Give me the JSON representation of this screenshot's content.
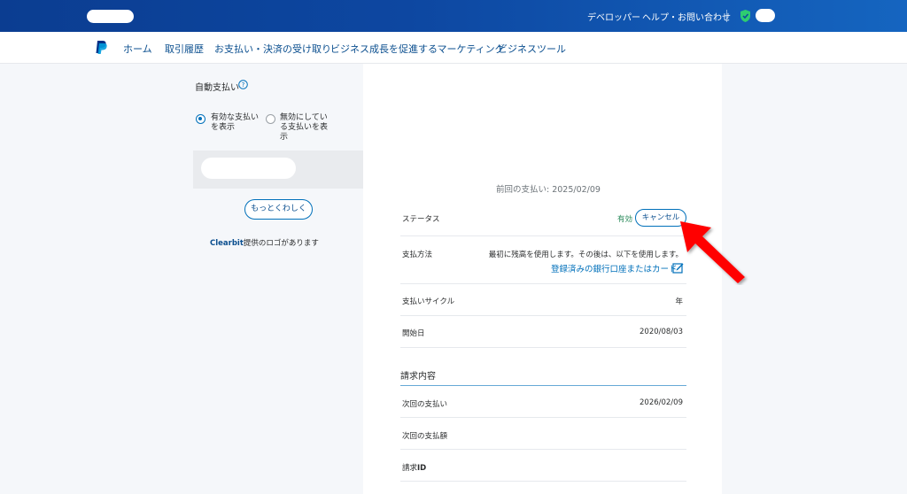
{
  "topbar": {
    "developer": "デベロッパー",
    "help": "ヘルプ・お問い合わせ"
  },
  "nav": {
    "items": [
      "ホーム",
      "取引履歴",
      "お支払い・決済の受け取り",
      "ビジネス成長を促進するマーケティング",
      "ビジネスツール"
    ]
  },
  "sidebar": {
    "title": "自動支払い",
    "radio_active": "有効な支払いを表示",
    "radio_inactive": "無効にしている支払いを表示",
    "more_button": "もっとくわしく",
    "clearbit_brand": "Clearbit",
    "clearbit_rest": "提供のロゴがあります"
  },
  "main": {
    "last_payment": "前回の支払い: 2025/02/09",
    "status_label": "ステータス",
    "status_value": "有効",
    "cancel_button": "キャンセル",
    "method_label": "支払方法",
    "method_desc": "最初に残高を使用します。その後は、以下を使用します。",
    "method_link": "登録済みの銀行口座またはカード",
    "cycle_label": "支払いサイクル",
    "cycle_value": "年",
    "start_label": "開始日",
    "start_value": "2020/08/03",
    "billing_title": "請求内容",
    "next_payment_label": "次回の支払い",
    "next_payment_value": "2026/02/09",
    "next_amount_label": "次回の支払額",
    "billing_id_label_prefix": "請求",
    "billing_id_label_bold": "ID"
  },
  "colors": {
    "topbar": "#0d47a1",
    "link": "#0070ba",
    "active": "#2a8a5b",
    "arrow": "#ff0000"
  },
  "icons": [
    "shield-icon",
    "paypal-logo-icon",
    "help-circle-icon",
    "edit-icon",
    "red-arrow-annotation"
  ]
}
